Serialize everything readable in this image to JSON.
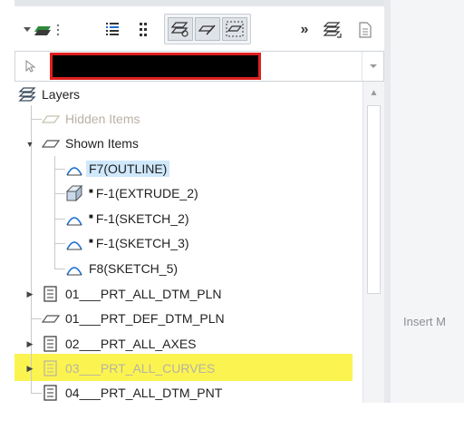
{
  "tree": {
    "root_label": "Layers",
    "items": [
      {
        "label": "Hidden Items",
        "style": "muted",
        "icon": "layer-outline-icon"
      },
      {
        "label": "Shown Items",
        "icon": "layer-outline-icon"
      },
      {
        "label": "F7(OUTLINE)",
        "icon": "sketch-curve-icon",
        "selected": true
      },
      {
        "label": "F-1(EXTRUDE_2)",
        "icon": "extrude-box-icon",
        "mark": "■"
      },
      {
        "label": "F-1(SKETCH_2)",
        "icon": "sketch-curve-icon",
        "mark": "■"
      },
      {
        "label": "F-1(SKETCH_3)",
        "icon": "sketch-curve-icon",
        "mark": "■"
      },
      {
        "label": "F8(SKETCH_5)",
        "icon": "sketch-curve-icon"
      },
      {
        "label": "01___PRT_ALL_DTM_PLN",
        "icon": "rule-layer-icon"
      },
      {
        "label": "01___PRT_DEF_DTM_PLN",
        "icon": "layer-outline-icon"
      },
      {
        "label": "02___PRT_ALL_AXES",
        "icon": "rule-layer-icon"
      },
      {
        "label": "03___PRT_ALL_CURVES",
        "icon": "rule-layer-icon",
        "style": "muted",
        "highlighted": true
      },
      {
        "label": "04___PRT_ALL_DTM_PNT",
        "icon": "rule-layer-icon"
      }
    ]
  },
  "right_pane": {
    "insert_text": "Insert M"
  },
  "colors": {
    "highlight": "#fbf450",
    "selection": "#cfe8fb",
    "filter_border": "#e02020"
  }
}
